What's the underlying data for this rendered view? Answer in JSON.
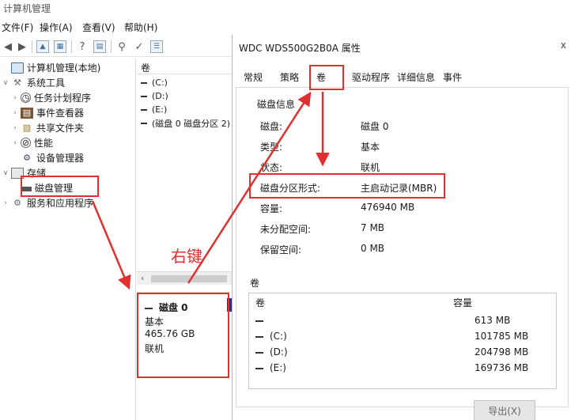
{
  "window": {
    "title": "计算机管理"
  },
  "menu": [
    {
      "label": "文件(F)"
    },
    {
      "label": "操作(A)"
    },
    {
      "label": "查看(V)"
    },
    {
      "label": "帮助(H)"
    }
  ],
  "tree": {
    "root": "计算机管理(本地)",
    "system_tools": "系统工具",
    "task_scheduler": "任务计划程序",
    "event_viewer": "事件查看器",
    "shared_folders": "共享文件夹",
    "performance": "性能",
    "device_manager": "设备管理器",
    "storage": "存储",
    "disk_management": "磁盘管理",
    "services_apps": "服务和应用程序"
  },
  "volume_pane": {
    "header": "卷",
    "items": [
      "(C:)",
      "(D:)",
      "(E:)",
      "(磁盘 0 磁盘分区 2)"
    ],
    "scroll_left": "‹"
  },
  "disk_panel": {
    "name": "磁盘 0",
    "type": "基本",
    "size": "465.76 GB",
    "status": "联机"
  },
  "annotation": {
    "right_click": "右键"
  },
  "dialog": {
    "title": "WDC WDS500G2B0A 属性",
    "close": "x",
    "tabs": [
      "常规",
      "策略",
      "卷",
      "驱动程序",
      "详细信息",
      "事件"
    ],
    "disk_info_title": "磁盘信息",
    "info": [
      {
        "label": "磁盘:",
        "value": "磁盘 0"
      },
      {
        "label": "类型:",
        "value": "基本"
      },
      {
        "label": "状态:",
        "value": "联机"
      },
      {
        "label": "磁盘分区形式:",
        "value": "主启动记录(MBR)"
      },
      {
        "label": "容量:",
        "value": "476940 MB"
      },
      {
        "label": "未分配空间:",
        "value": "7 MB"
      },
      {
        "label": "保留空间:",
        "value": "0 MB"
      }
    ],
    "volumes_title": "卷",
    "volume_headers": {
      "volume": "卷",
      "capacity": "容量"
    },
    "volumes": [
      {
        "name": "",
        "capacity": "613 MB"
      },
      {
        "name": "(C:)",
        "capacity": "101785 MB"
      },
      {
        "name": "(D:)",
        "capacity": "204798 MB"
      },
      {
        "name": "(E:)",
        "capacity": "169736 MB"
      }
    ],
    "button_label": "导出(X)"
  },
  "colors": {
    "annotation": "#e03030",
    "accent": "#3a6ea5"
  }
}
